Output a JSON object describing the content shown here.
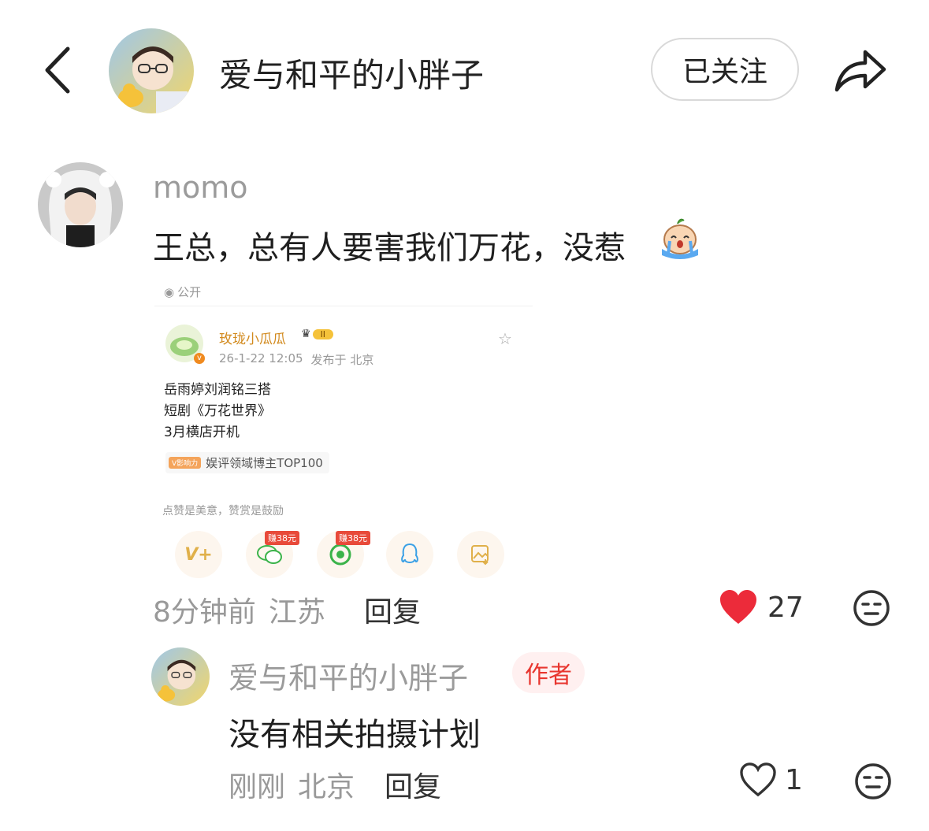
{
  "header": {
    "title": "爱与和平的小胖子",
    "follow_label": "已关注"
  },
  "comment": {
    "username": "momo",
    "text": "王总，总有人要害我们万花，没惹",
    "time": "8分钟前",
    "location": "江苏",
    "reply_label": "回复",
    "like_count": "27",
    "embedded_post": {
      "visibility": "公开",
      "author": "玫珑小瓜瓜",
      "level_badge": "II",
      "timestamp": "26-1-22 12:05",
      "published_from": "发布于 北京",
      "lines": [
        "岳雨婷刘润铭三搭",
        "短剧《万花世界》",
        "3月横店开机"
      ],
      "influence_badge": "V影响力",
      "influence_text": "娱评领域博主TOP100",
      "reward_hint": "点赞是美意，赞赏是鼓励",
      "earn_label_1": "赚38元",
      "earn_label_2": "赚38元"
    }
  },
  "reply": {
    "username": "爱与和平的小胖子",
    "author_tag": "作者",
    "text": "没有相关拍摄计划",
    "time": "刚刚",
    "location": "北京",
    "reply_label": "回复",
    "like_count": "1"
  },
  "colors": {
    "heart_red": "#ec2b3a",
    "author_tag_red": "#e8362f",
    "gray_text": "#999999"
  }
}
